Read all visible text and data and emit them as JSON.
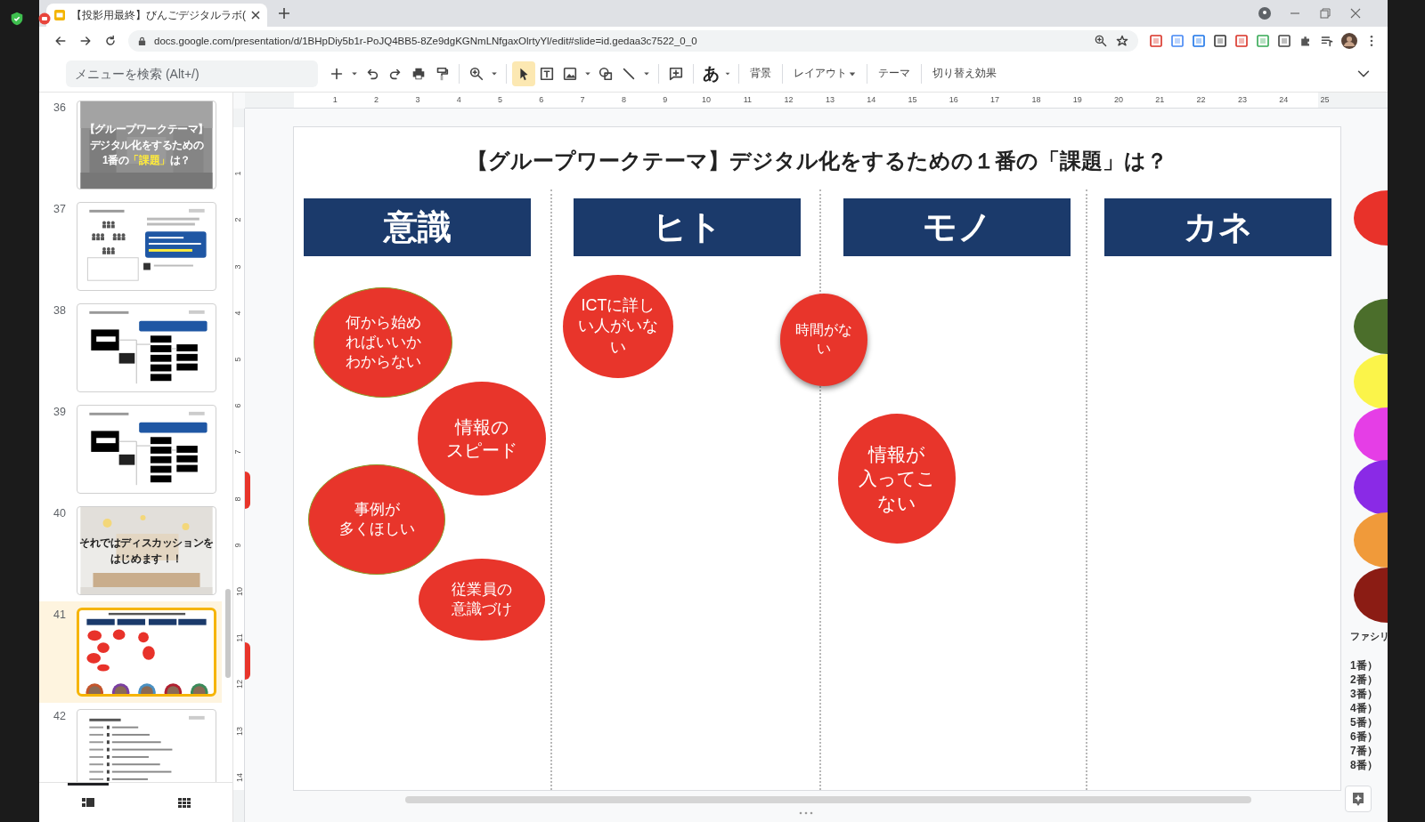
{
  "browser": {
    "tab_title": "【投影用最終】びんごデジタルラボ(",
    "url": "docs.google.com/presentation/d/1BHpDiy5b1r-PoJQ4BB5-8Ze9dgKGNmLNfgaxOlrtyYl/edit#slide=id.gedaa3c7522_0_0"
  },
  "toolbar": {
    "search_placeholder": "メニューを検索 (Alt+/)",
    "tools": [
      {
        "selected": true
      },
      {
        "selected": false
      },
      {
        "selected": false
      },
      {
        "selected": false
      },
      {
        "selected": false
      }
    ],
    "input_tool": "あ",
    "menu_buttons": [
      {
        "label": "背景",
        "kind": "plain"
      },
      {
        "label": "レイアウト",
        "kind": "dropdown"
      },
      {
        "label": "テーマ",
        "kind": "plain"
      },
      {
        "label": "切り替え効果",
        "kind": "plain"
      }
    ]
  },
  "filmstrip": {
    "slides": [
      {
        "number": "36",
        "selected": false,
        "kind": "darkphoto",
        "lines": [
          [
            {
              "text": "【グループワークテーマ】",
              "highlight": false
            }
          ],
          [
            {
              "text": "デジタル化をするための",
              "highlight": false
            }
          ],
          [
            {
              "text": "1番の",
              "highlight": false
            },
            {
              "text": "「課題」",
              "highlight": true
            },
            {
              "text": "は？",
              "highlight": false
            }
          ]
        ]
      },
      {
        "number": "37",
        "selected": false,
        "kind": "org"
      },
      {
        "number": "38",
        "selected": false,
        "kind": "flow"
      },
      {
        "number": "39",
        "selected": false,
        "kind": "flow"
      },
      {
        "number": "40",
        "selected": false,
        "kind": "lightphoto",
        "lines": [
          [
            {
              "text": "それではディスカッションを",
              "highlight": false
            }
          ],
          [
            {
              "text": "はじめます！！",
              "highlight": false
            }
          ]
        ]
      },
      {
        "number": "41",
        "selected": true,
        "kind": "board"
      },
      {
        "number": "42",
        "selected": false,
        "kind": "agenda"
      }
    ],
    "views": [
      {
        "selected": true
      },
      {
        "selected": false
      }
    ]
  },
  "rulers": {
    "horizontal": [
      "1",
      "2",
      "3",
      "4",
      "5",
      "6",
      "7",
      "8",
      "9",
      "10",
      "11",
      "12",
      "13",
      "14",
      "15",
      "16",
      "17",
      "18",
      "19",
      "20",
      "21",
      "22",
      "23",
      "24",
      "25"
    ],
    "vertical": [
      "1",
      "2",
      "3",
      "4",
      "5",
      "6",
      "7",
      "8",
      "9",
      "10",
      "11",
      "12",
      "13",
      "14"
    ]
  },
  "slide": {
    "title": "【グループワークテーマ】デジタル化をするための１番の「課題」は？",
    "columns": [
      {
        "header": "意識",
        "notes": [
          {
            "lines": [
              "何から始め",
              "ればいいか",
              "わからない"
            ],
            "outlined": true,
            "lifted": false
          },
          {
            "lines": [
              "情報の",
              "スピード"
            ],
            "outlined": false,
            "lifted": false
          },
          {
            "lines": [
              "事例が",
              "多くほしい"
            ],
            "outlined": true,
            "lifted": false
          },
          {
            "lines": [
              "従業員の",
              "意識づけ"
            ],
            "outlined": false,
            "lifted": false
          }
        ]
      },
      {
        "header": "ヒト",
        "notes": [
          {
            "lines": [
              "ICTに詳し",
              "い人がいな",
              "い"
            ],
            "outlined": false,
            "lifted": false
          }
        ]
      },
      {
        "header": "モノ",
        "notes": [
          {
            "lines": [
              "時間がな",
              "い"
            ],
            "outlined": false,
            "lifted": true
          },
          {
            "lines": [
              "情報が",
              "入ってこ",
              "ない"
            ],
            "outlined": false,
            "lifted": false
          }
        ]
      },
      {
        "header": "カネ"
      }
    ]
  },
  "off_slide": {
    "dots": [
      {
        "color": "#e8322a"
      },
      {
        "color": "#4b6e2b"
      },
      {
        "color": "#fbf44a"
      },
      {
        "color": "#e53ee6"
      },
      {
        "color": "#8a2ae6"
      },
      {
        "color": "#f09a3a"
      },
      {
        "color": "#8b1c14"
      }
    ],
    "label": "ファシリ",
    "items": [
      "1番）",
      "2番）",
      "3番）",
      "4番）",
      "5番）",
      "6番）",
      "7番）",
      "8番）"
    ]
  }
}
